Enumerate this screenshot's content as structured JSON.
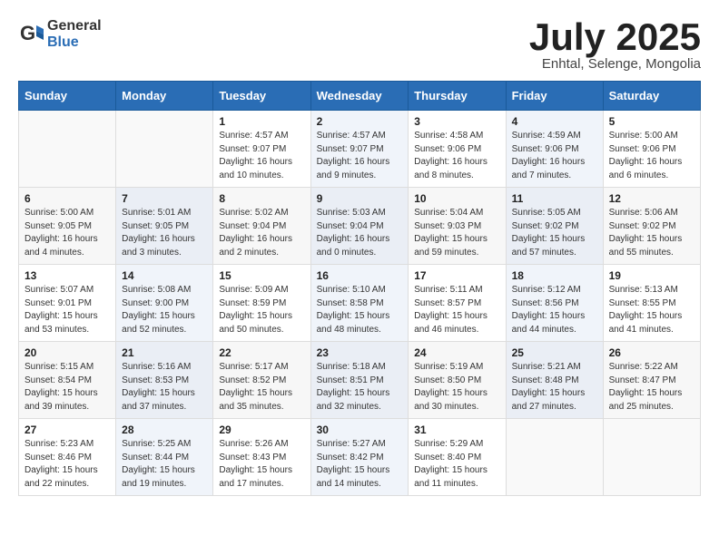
{
  "header": {
    "logo_general": "General",
    "logo_blue": "Blue",
    "month_title": "July 2025",
    "subtitle": "Enhtal, Selenge, Mongolia"
  },
  "calendar": {
    "weekdays": [
      "Sunday",
      "Monday",
      "Tuesday",
      "Wednesday",
      "Thursday",
      "Friday",
      "Saturday"
    ],
    "weeks": [
      [
        {
          "day": "",
          "detail": ""
        },
        {
          "day": "",
          "detail": ""
        },
        {
          "day": "1",
          "detail": "Sunrise: 4:57 AM\nSunset: 9:07 PM\nDaylight: 16 hours\nand 10 minutes."
        },
        {
          "day": "2",
          "detail": "Sunrise: 4:57 AM\nSunset: 9:07 PM\nDaylight: 16 hours\nand 9 minutes."
        },
        {
          "day": "3",
          "detail": "Sunrise: 4:58 AM\nSunset: 9:06 PM\nDaylight: 16 hours\nand 8 minutes."
        },
        {
          "day": "4",
          "detail": "Sunrise: 4:59 AM\nSunset: 9:06 PM\nDaylight: 16 hours\nand 7 minutes."
        },
        {
          "day": "5",
          "detail": "Sunrise: 5:00 AM\nSunset: 9:06 PM\nDaylight: 16 hours\nand 6 minutes."
        }
      ],
      [
        {
          "day": "6",
          "detail": "Sunrise: 5:00 AM\nSunset: 9:05 PM\nDaylight: 16 hours\nand 4 minutes."
        },
        {
          "day": "7",
          "detail": "Sunrise: 5:01 AM\nSunset: 9:05 PM\nDaylight: 16 hours\nand 3 minutes."
        },
        {
          "day": "8",
          "detail": "Sunrise: 5:02 AM\nSunset: 9:04 PM\nDaylight: 16 hours\nand 2 minutes."
        },
        {
          "day": "9",
          "detail": "Sunrise: 5:03 AM\nSunset: 9:04 PM\nDaylight: 16 hours\nand 0 minutes."
        },
        {
          "day": "10",
          "detail": "Sunrise: 5:04 AM\nSunset: 9:03 PM\nDaylight: 15 hours\nand 59 minutes."
        },
        {
          "day": "11",
          "detail": "Sunrise: 5:05 AM\nSunset: 9:02 PM\nDaylight: 15 hours\nand 57 minutes."
        },
        {
          "day": "12",
          "detail": "Sunrise: 5:06 AM\nSunset: 9:02 PM\nDaylight: 15 hours\nand 55 minutes."
        }
      ],
      [
        {
          "day": "13",
          "detail": "Sunrise: 5:07 AM\nSunset: 9:01 PM\nDaylight: 15 hours\nand 53 minutes."
        },
        {
          "day": "14",
          "detail": "Sunrise: 5:08 AM\nSunset: 9:00 PM\nDaylight: 15 hours\nand 52 minutes."
        },
        {
          "day": "15",
          "detail": "Sunrise: 5:09 AM\nSunset: 8:59 PM\nDaylight: 15 hours\nand 50 minutes."
        },
        {
          "day": "16",
          "detail": "Sunrise: 5:10 AM\nSunset: 8:58 PM\nDaylight: 15 hours\nand 48 minutes."
        },
        {
          "day": "17",
          "detail": "Sunrise: 5:11 AM\nSunset: 8:57 PM\nDaylight: 15 hours\nand 46 minutes."
        },
        {
          "day": "18",
          "detail": "Sunrise: 5:12 AM\nSunset: 8:56 PM\nDaylight: 15 hours\nand 44 minutes."
        },
        {
          "day": "19",
          "detail": "Sunrise: 5:13 AM\nSunset: 8:55 PM\nDaylight: 15 hours\nand 41 minutes."
        }
      ],
      [
        {
          "day": "20",
          "detail": "Sunrise: 5:15 AM\nSunset: 8:54 PM\nDaylight: 15 hours\nand 39 minutes."
        },
        {
          "day": "21",
          "detail": "Sunrise: 5:16 AM\nSunset: 8:53 PM\nDaylight: 15 hours\nand 37 minutes."
        },
        {
          "day": "22",
          "detail": "Sunrise: 5:17 AM\nSunset: 8:52 PM\nDaylight: 15 hours\nand 35 minutes."
        },
        {
          "day": "23",
          "detail": "Sunrise: 5:18 AM\nSunset: 8:51 PM\nDaylight: 15 hours\nand 32 minutes."
        },
        {
          "day": "24",
          "detail": "Sunrise: 5:19 AM\nSunset: 8:50 PM\nDaylight: 15 hours\nand 30 minutes."
        },
        {
          "day": "25",
          "detail": "Sunrise: 5:21 AM\nSunset: 8:48 PM\nDaylight: 15 hours\nand 27 minutes."
        },
        {
          "day": "26",
          "detail": "Sunrise: 5:22 AM\nSunset: 8:47 PM\nDaylight: 15 hours\nand 25 minutes."
        }
      ],
      [
        {
          "day": "27",
          "detail": "Sunrise: 5:23 AM\nSunset: 8:46 PM\nDaylight: 15 hours\nand 22 minutes."
        },
        {
          "day": "28",
          "detail": "Sunrise: 5:25 AM\nSunset: 8:44 PM\nDaylight: 15 hours\nand 19 minutes."
        },
        {
          "day": "29",
          "detail": "Sunrise: 5:26 AM\nSunset: 8:43 PM\nDaylight: 15 hours\nand 17 minutes."
        },
        {
          "day": "30",
          "detail": "Sunrise: 5:27 AM\nSunset: 8:42 PM\nDaylight: 15 hours\nand 14 minutes."
        },
        {
          "day": "31",
          "detail": "Sunrise: 5:29 AM\nSunset: 8:40 PM\nDaylight: 15 hours\nand 11 minutes."
        },
        {
          "day": "",
          "detail": ""
        },
        {
          "day": "",
          "detail": ""
        }
      ]
    ]
  }
}
